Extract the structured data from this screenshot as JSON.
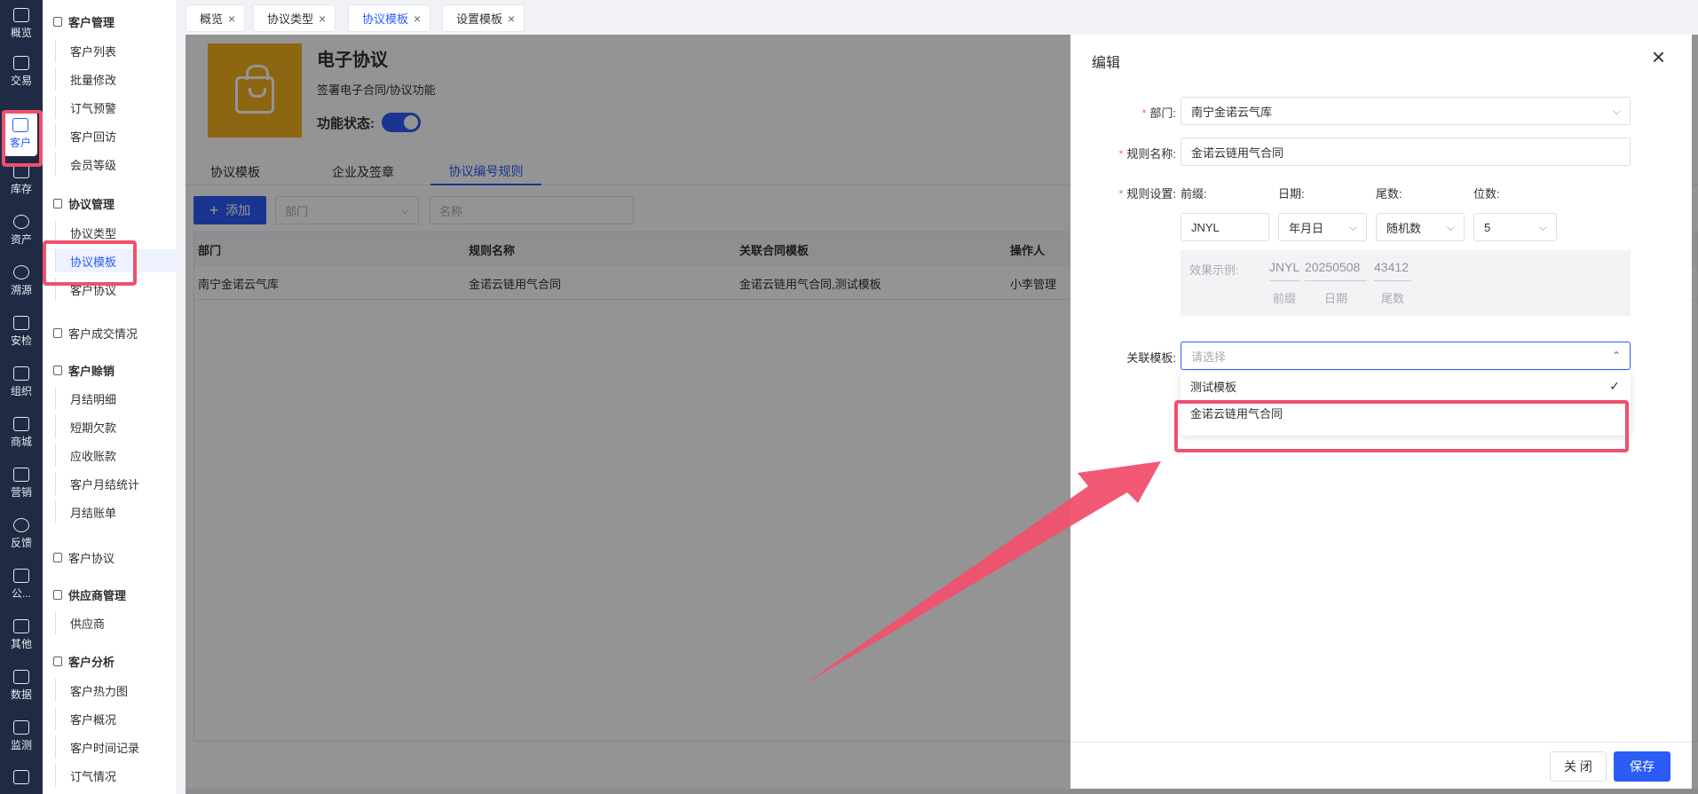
{
  "rail": {
    "items": [
      {
        "label": "概览",
        "icon": "chart-line-icon"
      },
      {
        "label": "交易",
        "icon": "bag-icon"
      },
      {
        "label": "客户",
        "icon": "id-card-icon"
      },
      {
        "label": "库存",
        "icon": "list-icon"
      },
      {
        "label": "资产",
        "icon": "bulb-icon"
      },
      {
        "label": "溯源",
        "icon": "compass-icon"
      },
      {
        "label": "安检",
        "icon": "shield-icon"
      },
      {
        "label": "组织",
        "icon": "org-icon"
      },
      {
        "label": "商城",
        "icon": "store-icon"
      },
      {
        "label": "营销",
        "icon": "trophy-icon"
      },
      {
        "label": "反馈",
        "icon": "chat-icon"
      },
      {
        "label": "公...",
        "icon": "megaphone-icon"
      },
      {
        "label": "其他",
        "icon": "grid-plus-icon"
      },
      {
        "label": "数据",
        "icon": "chart-icon"
      },
      {
        "label": "监测",
        "icon": "alarm-icon"
      },
      {
        "label": "",
        "icon": "apps-icon"
      }
    ]
  },
  "sidebar": {
    "groups": [
      {
        "label": "客户管理",
        "items": [
          "客户列表",
          "批量修改",
          "订气预警",
          "客户回访",
          "会员等级"
        ]
      },
      {
        "label": "协议管理",
        "items": [
          "协议类型",
          "协议模板",
          "客户协议"
        ]
      },
      {
        "label": "客户成交情况",
        "items": []
      },
      {
        "label": "客户赊销",
        "items": [
          "月结明细",
          "短期欠款",
          "应收账款",
          "客户月结统计",
          "月结账单"
        ]
      },
      {
        "label": "客户协议",
        "items": []
      },
      {
        "label": "供应商管理",
        "items": [
          "供应商"
        ]
      },
      {
        "label": "客户分析",
        "items": [
          "客户热力图",
          "客户概况",
          "客户时间记录",
          "订气情况"
        ]
      }
    ]
  },
  "tabs": [
    "概览",
    "协议类型",
    "协议模板",
    "设置模板"
  ],
  "hero": {
    "title": "电子协议",
    "desc": "签署电子合同/协议功能",
    "status_label": "功能状态:"
  },
  "subtabs": [
    "协议模板",
    "企业及签章",
    "协议编号规则"
  ],
  "toolbar": {
    "add_label": "添加",
    "dept_placeholder": "部门",
    "name_placeholder": "名称"
  },
  "table": {
    "headers": [
      "部门",
      "规则名称",
      "关联合同模板",
      "操作人"
    ],
    "rows": [
      [
        "南宁金诺云气库",
        "金诺云链用气合同",
        "金诺云链用气合同,测试模板",
        "小李管理"
      ]
    ]
  },
  "drawer": {
    "title": "编辑",
    "dept_label": "部门:",
    "dept_value": "南宁金诺云气库",
    "rule_name_label": "规则名称:",
    "rule_name_value": "金诺云链用气合同",
    "rule_setting_label": "规则设置:",
    "prefix_label": "前缀:",
    "date_label": "日期:",
    "tail_label": "尾数:",
    "digits_label": "位数:",
    "prefix_value": "JNYL",
    "date_value": "年月日",
    "tail_value": "随机数",
    "digits_value": "5",
    "example_label": "效果示例:",
    "example_prefix": "JNYL",
    "example_date": "20250508",
    "example_tail": "43412",
    "example_prefix_caption": "前缀",
    "example_date_caption": "日期",
    "example_tail_caption": "尾数",
    "template_label": "关联模板:",
    "template_placeholder": "请选择",
    "options": [
      "测试模板",
      "金诺云链用气合同"
    ],
    "close_label": "关 闭",
    "save_label": "保存"
  },
  "colors": {
    "accent": "#2b5cf6",
    "highlight": "#f0506e",
    "hero": "#f3b020"
  }
}
